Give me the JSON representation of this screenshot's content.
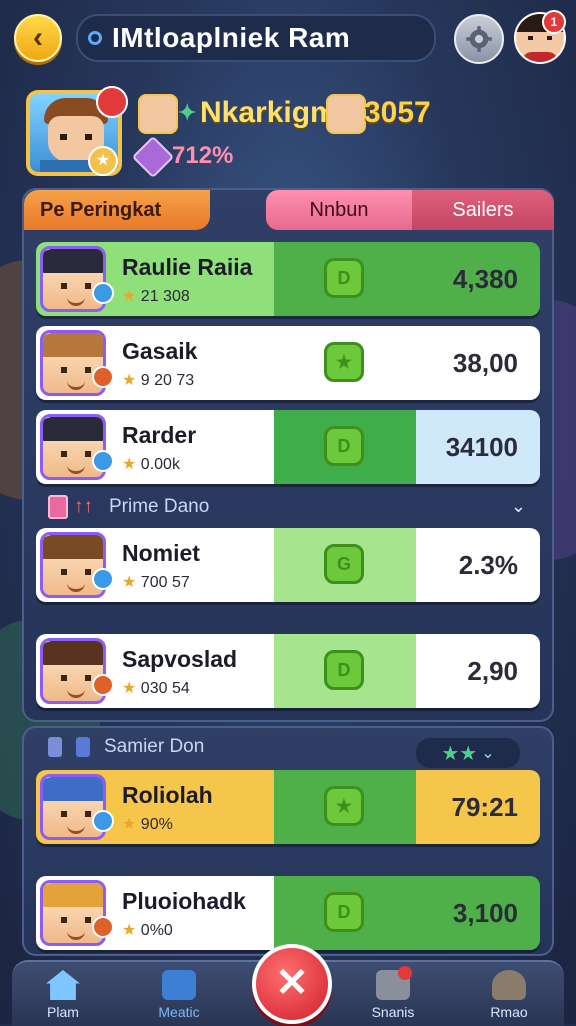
{
  "header": {
    "title": "IMtloaplniek Ram",
    "notification_count": "1",
    "player_name": "Nkarkigm",
    "player_score": "3057",
    "player_rate": "712%"
  },
  "tabs": {
    "left": "Pe Peringkat",
    "mid": "Nnbun",
    "right": "Sailers"
  },
  "rows_top": [
    {
      "name": "Raulie Raiia",
      "sub": "21 308",
      "value": "4,380",
      "mid_color": "#4fb04a",
      "left_color": "#8fe07a",
      "right_color": "#4fb04a",
      "hat": "#2a2a3a",
      "gem_shape": "D"
    },
    {
      "name": "Gasaik",
      "sub": "9 20 73",
      "value": "38,00",
      "mid_color": "#ffffff",
      "left_color": "#ffffff",
      "right_color": "#ffffff",
      "hat": "#b5783a",
      "gem_shape": "★"
    },
    {
      "name": "Rarder",
      "sub": "0.00k",
      "value": "34100",
      "mid_color": "#3fae4a",
      "left_color": "#ffffff",
      "right_color": "#cfe9fb",
      "hat": "#2a2a3a",
      "gem_shape": "D"
    }
  ],
  "section1": {
    "label": "Prime Dano"
  },
  "rows_mid": [
    {
      "name": "Nomiet",
      "sub": "700 57",
      "value": "2.3%",
      "mid_color": "#a6e58e",
      "left_color": "#ffffff",
      "right_color": "#ffffff",
      "hat": "#7a4a26",
      "gem_shape": "G"
    },
    {
      "name": "Sapvoslad",
      "sub": "030 54",
      "value": "2,90",
      "mid_color": "#a6e58e",
      "left_color": "#ffffff",
      "right_color": "#ffffff",
      "hat": "#5a3320",
      "gem_shape": "D"
    }
  ],
  "section2": {
    "label": "Samier Don"
  },
  "rows_bottom": [
    {
      "name": "Roliolah",
      "sub": "90%",
      "value": "79:21",
      "mid_color": "#4fb04a",
      "left_color": "#f6c64a",
      "right_color": "#f6c64a",
      "hat": "#3f6cc7",
      "gem_shape": "★"
    },
    {
      "name": "Pluoiohadk",
      "sub": "0%0",
      "value": "3,100",
      "mid_color": "#4fb04a",
      "left_color": "#ffffff",
      "right_color": "#4fb04a",
      "hat": "#e3a23a",
      "gem_shape": "D"
    }
  ],
  "nav": {
    "home": "Plam",
    "mid": "Meatic",
    "stats": "Snanis",
    "profile": "Rmao"
  },
  "icons": [
    "back-arrow-icon",
    "settings-gear-icon",
    "close-icon",
    "home-icon",
    "book-icon",
    "trophy-icon",
    "profile-icon",
    "star-icon",
    "gem-icon",
    "chevron-down-icon"
  ]
}
